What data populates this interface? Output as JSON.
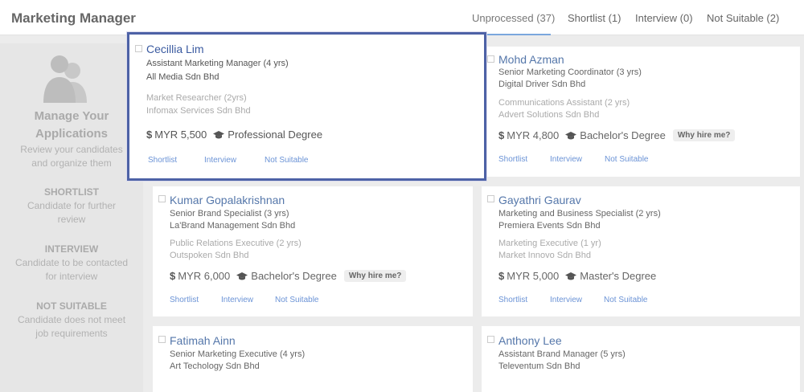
{
  "header": {
    "title": "Marketing Manager",
    "tabs": [
      {
        "label": "Unprocessed (37)",
        "active": true
      },
      {
        "label": "Shortlist (1)",
        "active": false
      },
      {
        "label": "Interview (0)",
        "active": false
      },
      {
        "label": "Not Suitable (2)",
        "active": false
      }
    ]
  },
  "sidebar": {
    "title_line1": "Manage Your",
    "title_line2": "Applications",
    "subtitle_line1": "Review your candidates",
    "subtitle_line2": "and organize them",
    "sections": [
      {
        "heading": "SHORTLIST",
        "desc_line1": "Candidate for further",
        "desc_line2": "review"
      },
      {
        "heading": "INTERVIEW",
        "desc_line1": "Candidate to be contacted",
        "desc_line2": "for interview"
      },
      {
        "heading": "NOT SUITABLE",
        "desc_line1": "Candidate does not meet",
        "desc_line2": "job requirements"
      }
    ]
  },
  "actions": {
    "shortlist": "Shortlist",
    "interview": "Interview",
    "not_suitable": "Not Suitable",
    "why_hire": "Why hire me?"
  },
  "candidates": [
    {
      "name": "Cecillia Lim",
      "role": "Assistant Marketing Manager (4 yrs)",
      "company": "All Media Sdn Bhd",
      "prev_role": "Market Researcher (2yrs)",
      "prev_company": "Infomax Services Sdn Bhd",
      "salary": "MYR 5,500",
      "degree": "Professional Degree"
    },
    {
      "name": "Mohd Azman",
      "role": "Senior Marketing Coordinator (3 yrs)",
      "company": "Digital Driver Sdn Bhd",
      "prev_role": "Communications Assistant (2 yrs)",
      "prev_company": "Advert Solutions Sdn Bhd",
      "salary": "MYR 4,800",
      "degree": "Bachelor's Degree"
    },
    {
      "name": "Kumar Gopalakrishnan",
      "role": "Senior Brand Specialist (3 yrs)",
      "company": "La'Brand Management Sdn Bhd",
      "prev_role": "Public Relations Executive (2 yrs)",
      "prev_company": "Outspoken Sdn Bhd",
      "salary": "MYR 6,000",
      "degree": "Bachelor's Degree"
    },
    {
      "name": "Gayathri Gaurav",
      "role": "Marketing and Business Specialist (2 yrs)",
      "company": "Premiera Events Sdn Bhd",
      "prev_role": "Marketing Executive (1 yr)",
      "prev_company": "Market Innovo Sdn Bhd",
      "salary": "MYR 5,000",
      "degree": "Master's Degree"
    },
    {
      "name": "Fatimah Ainn",
      "role": "Senior Marketing Executive (4 yrs)",
      "company": "Art Techology Sdn Bhd"
    },
    {
      "name": "Anthony Lee",
      "role": "Assistant Brand Manager (5 yrs)",
      "company": "Televentum Sdn Bhd"
    }
  ],
  "colors": {
    "accent": "#6b93d6",
    "highlight_border": "#4d62a6",
    "tab_underline": "#7aa7dd"
  },
  "icons": [
    "people-icon",
    "graduation-cap-icon",
    "checkbox-icon"
  ]
}
